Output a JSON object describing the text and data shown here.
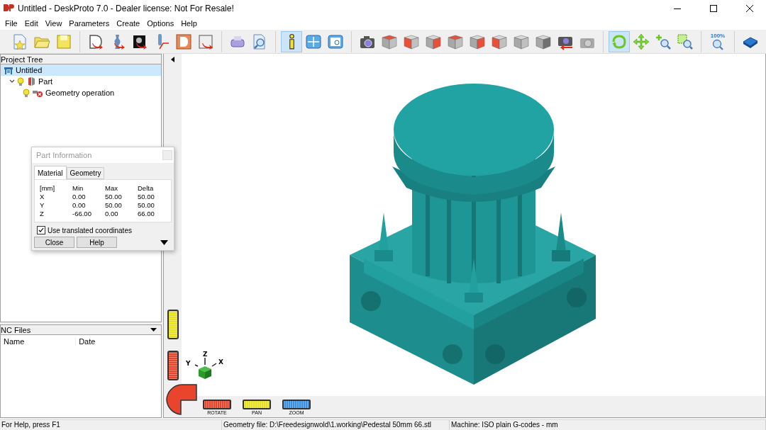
{
  "window": {
    "title": "Untitled - DeskProto 7.0 - Dealer license: Not For Resale!"
  },
  "menu": [
    "File",
    "Edit",
    "View",
    "Parameters",
    "Create",
    "Options",
    "Help"
  ],
  "toolbar": [
    {
      "buttons": [
        {
          "kind": "new",
          "selected": false
        },
        {
          "kind": "open",
          "selected": false
        },
        {
          "kind": "save",
          "selected": false
        }
      ]
    },
    {
      "buttons": [
        {
          "kind": "part-arrow",
          "selected": false
        },
        {
          "kind": "vase-arrow",
          "selected": false
        },
        {
          "kind": "image-arrow",
          "selected": false
        },
        {
          "kind": "tool",
          "selected": false
        },
        {
          "kind": "part-box",
          "selected": false
        },
        {
          "kind": "save-arrow",
          "selected": false
        }
      ]
    },
    {
      "buttons": [
        {
          "kind": "print",
          "selected": false
        },
        {
          "kind": "preview",
          "selected": false
        }
      ]
    },
    {
      "buttons": [
        {
          "kind": "info",
          "selected": true
        },
        {
          "kind": "layout",
          "selected": false
        },
        {
          "kind": "report",
          "selected": false
        }
      ]
    },
    {
      "buttons": [
        {
          "kind": "camera",
          "selected": false
        },
        {
          "kind": "cube-top",
          "selected": false
        },
        {
          "kind": "cube-front",
          "selected": false
        },
        {
          "kind": "cube-right",
          "selected": false
        },
        {
          "kind": "cube-bottom",
          "selected": false
        },
        {
          "kind": "cube-back",
          "selected": false
        },
        {
          "kind": "cube-left",
          "selected": false
        },
        {
          "kind": "cube-iso",
          "selected": false
        },
        {
          "kind": "cube-shaded",
          "selected": false
        },
        {
          "kind": "camera-arrow",
          "selected": false
        },
        {
          "kind": "camera-grey",
          "selected": false
        }
      ]
    },
    {
      "buttons": [
        {
          "kind": "rotate",
          "selected": true
        },
        {
          "kind": "pan",
          "selected": false
        },
        {
          "kind": "zoom-in",
          "selected": false
        },
        {
          "kind": "zoom-window",
          "selected": false
        }
      ]
    },
    {
      "buttons": [
        {
          "kind": "zoom-all",
          "label": "100%",
          "selected": false
        }
      ]
    },
    {
      "buttons": [
        {
          "kind": "help",
          "selected": false
        }
      ]
    }
  ],
  "project_tree": {
    "title": "Project Tree",
    "items": [
      {
        "label": "Untitled",
        "kind": "project",
        "selected": true,
        "children": [
          {
            "label": "Part",
            "kind": "part",
            "selected": false,
            "expanded": true,
            "children": [
              {
                "label": "Geometry operation",
                "kind": "operation",
                "selected": false
              }
            ]
          }
        ]
      }
    ]
  },
  "part_information": {
    "title": "Part Information",
    "tabs": [
      {
        "label": "Material",
        "selected": true
      },
      {
        "label": "Geometry",
        "selected": false
      }
    ],
    "columns": [
      "[mm]",
      "Min",
      "Max",
      "Delta"
    ],
    "rows": [
      [
        "X",
        "0.00",
        "50.00",
        "50.00"
      ],
      [
        "Y",
        "0.00",
        "50.00",
        "50.00"
      ],
      [
        "Z",
        "-66.00",
        "0.00",
        "66.00"
      ]
    ],
    "checkbox": {
      "label": "Use translated coordinates",
      "checked": true
    },
    "buttons": [
      "Close",
      "Help"
    ]
  },
  "nc_files": {
    "title": "NC Files",
    "columns": [
      "Name",
      "Date"
    ]
  },
  "viewport": {
    "axes": [
      "Y",
      "Z",
      "X"
    ],
    "wheels": [
      {
        "label": "ROTATE",
        "color": "#e8452c"
      },
      {
        "label": "PAN",
        "color": "#e6e020"
      },
      {
        "label": "ZOOM",
        "color": "#3b8fe0"
      }
    ]
  },
  "status_bar": [
    "For Help, press F1",
    "Geometry file: D:\\Freedesignwold\\1.working\\Pedestal 50mm 66.stl",
    "Machine: ISO plain G-codes - mm"
  ]
}
